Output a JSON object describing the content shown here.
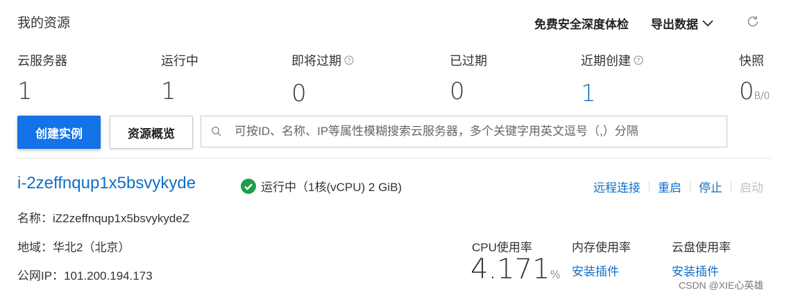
{
  "header": {
    "title": "我的资源",
    "security_check": "免费安全深度体检",
    "export_data": "导出数据"
  },
  "stats": [
    {
      "label": "云服务器",
      "value": "1",
      "help": false
    },
    {
      "label": "运行中",
      "value": "1",
      "help": false
    },
    {
      "label": "即将过期",
      "value": "0",
      "help": true
    },
    {
      "label": "已过期",
      "value": "0",
      "help": false
    },
    {
      "label": "近期创建",
      "value": "1",
      "help": true
    },
    {
      "label": "快照",
      "value": "0",
      "unit": "B/0",
      "help": false
    }
  ],
  "toolbar": {
    "create_instance": "创建实例",
    "resource_overview": "资源概览",
    "search_placeholder": "可按ID、名称、IP等属性模糊搜索云服务器，多个关键字用英文逗号（,）分隔"
  },
  "instance": {
    "id": "i-2zeffnqup1x5bsvykyde",
    "status_text": "运行中（1核(vCPU) 2 GiB)",
    "name_label": "名称：",
    "name_value": "iZ2zeffnqup1x5bsvykydeZ",
    "region_label": "地域：",
    "region_value": "华北2（北京）",
    "ip_label": "公网IP：",
    "ip_value": "101.200.194.173",
    "actions": {
      "remote": "远程连接",
      "restart": "重启",
      "stop": "停止",
      "start": "启动"
    },
    "metrics": {
      "cpu_label": "CPU使用率",
      "cpu_value": "4.171",
      "cpu_unit": "%",
      "mem_label": "内存使用率",
      "mem_action": "安装插件",
      "disk_label": "云盘使用率",
      "disk_action": "安装插件"
    }
  },
  "watermark": "CSDN @XIE心英雄",
  "colors": {
    "primary": "#1473e6",
    "link": "#0f6fc6",
    "status_green": "#1e9e4a",
    "disabled": "#c0c0c0"
  }
}
